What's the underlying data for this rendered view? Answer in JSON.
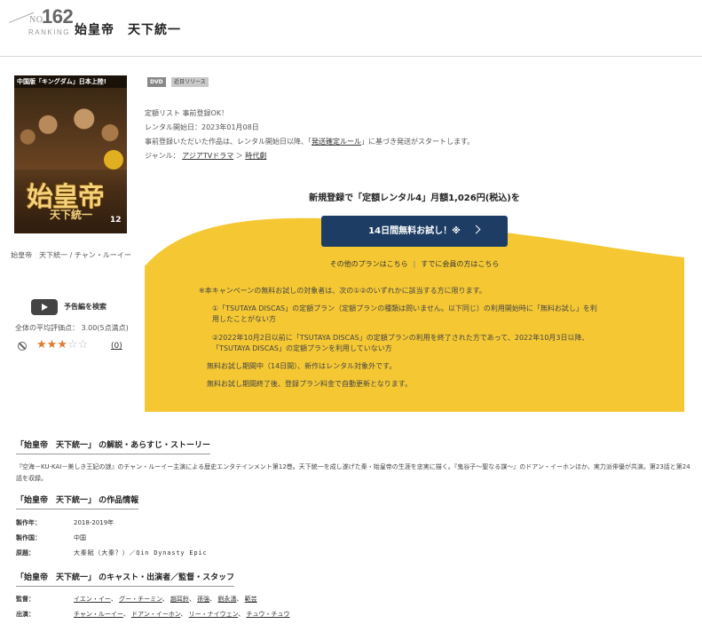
{
  "header": {
    "rank_prefix": "NO.",
    "rank_number": "162",
    "rank_label": "RANKING",
    "title": "始皇帝　天下統一"
  },
  "poster": {
    "top_tag": "中国版「キングダム」日本上陸!",
    "title_text": "始皇帝",
    "subtitle_text": "天下統一",
    "volume": "12"
  },
  "left": {
    "caption": "始皇帝　天下統一 / チャン・ルーイー",
    "trailer_label": "予告編を検索",
    "avg_rating": "全体の平均評価点： 3.00(5点満点)",
    "stars_filled": 3,
    "stars_total": 5,
    "review_count": "(0)"
  },
  "badges": {
    "format": "DVD",
    "release": "近日リリース"
  },
  "info": {
    "line1": "定額リスト 事前登録OK！",
    "line2": "レンタル開始日：2023年01月08日",
    "line3_pre": "事前登録いただいた作品は、レンタル開始日以降、「",
    "line3_link": "発送確定ルール",
    "line3_post": "」に基づき発送がスタートします。",
    "genre_label": "ジャンル：",
    "genre_main": "アジアTVドラマ",
    "genre_arrow": "＞",
    "genre_sub": "時代劇"
  },
  "campaign": {
    "headline": "新規登録で「定額レンタル4」月額1,026円(税込)を",
    "button_label": "14日間無料お試し！※",
    "other_plans": "その他のプランはこちら",
    "separator": "|",
    "members": "すでに会員の方はこちら",
    "note_main": "※本キャンペーンの無料お試しの対象者は、次の①②のいずれかに該当する方に限ります。",
    "note_1a": "①「TSUTAYA DISCAS」の定額プラン（定額プランの種類は問いません。以下同じ）の利用開始時に「無料お試し」を利",
    "note_1b": "用したことがない方",
    "note_2a": "②2022年10月2日以前に「TSUTAYA DISCAS」の定額プランの利用を終了された方であって、2022年10月3日以降、",
    "note_2b": "「TSUTAYA DISCAS」の定額プランを利用していない方",
    "note_3": "無料お試し期間中（14日間）、新作はレンタル対象外です。",
    "note_4": "無料お試し期間終了後、登録プラン料金で自動更新となります。",
    "box_color": "#f5c833",
    "button_color": "#1d3d64"
  },
  "story_section": {
    "title": "「始皇帝　天下統一」 の解説・あらすじ・ストーリー",
    "text": "『空海－KU-KAI－美しき王妃の謎』のチャン・ルーイー主演による歴史エンタテインメント第12巻。天下統一を成し遂げた秦・始皇帝の生涯を忠実に描く。『鬼谷子～聖なる謀～』のドアン・イーホンほか、実力派俳優が共演。第23話と第24話を収録。"
  },
  "work_info": {
    "title": "「始皇帝　天下統一」 の作品情報",
    "year_label": "製作年：",
    "year_value": "2018-2019年",
    "country_label": "製作国：",
    "country_value": "中国",
    "original_label": "原題：",
    "original_value": "大秦賦（大秦？）／Qin Dynasty Epic"
  },
  "cast_section": {
    "title": "「始皇帝　天下統一」 のキャスト・出演者／監督・スタッフ",
    "director_label": "監督：",
    "directors": [
      "イエン・イー",
      "グー・チーミン",
      "趙耳鈴",
      "孫強",
      "劉永濤",
      "範芸"
    ],
    "cast_label": "出演：",
    "cast": [
      "チャン・ルーイー",
      "ドアン・イーホン",
      "リー・ナイウェン",
      "チュウ・チュウ"
    ]
  }
}
